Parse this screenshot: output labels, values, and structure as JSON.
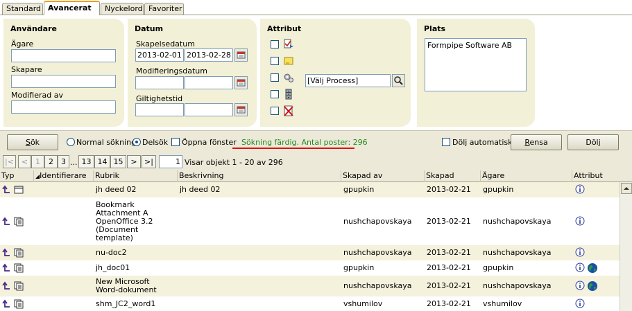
{
  "tabs": [
    {
      "label": "Standard"
    },
    {
      "label": "Avancerat"
    },
    {
      "label": "Nyckelord"
    },
    {
      "label": "Favoriter"
    }
  ],
  "panels": {
    "users": {
      "title": "Användare",
      "owner_label": "Ägare",
      "owner_value": "",
      "creator_label": "Skapare",
      "creator_value": "",
      "modified_by_label": "Modifierad av",
      "modified_by_value": ""
    },
    "dates": {
      "title": "Datum",
      "created_label": "Skapelsedatum",
      "created_from": "2013-02-01",
      "created_to": "2013-02-28",
      "modified_label": "Modifieringsdatum",
      "modified_from": "",
      "modified_to": "",
      "valid_label": "Giltighetstid",
      "valid_from": "",
      "valid_to": ""
    },
    "attributes": {
      "title": "Attribut",
      "process_value": "[Välj Process]"
    },
    "location": {
      "title": "Plats",
      "selected": "Formpipe Software AB"
    }
  },
  "toolbar": {
    "search_label": "Sök",
    "search_mnemonic": "S",
    "search_rest": "ök",
    "normal_search": "Normal sökning",
    "partial_search": "Delsök",
    "open_window": "Öppna fönster",
    "status": "Sökning färdig. Antal poster: 296",
    "hide_auto": "Dölj automatiskt",
    "clear_mnemonic": "R",
    "clear_rest": "ensa",
    "hide_label": "Dölj"
  },
  "pager": {
    "buttons": [
      "|<",
      "<",
      "1",
      "2",
      "3",
      "...",
      "13",
      "14",
      "15",
      ">",
      ">|"
    ],
    "page_value": "1",
    "info": "Visar objekt 1 - 20 av 296"
  },
  "table": {
    "columns": [
      "Typ",
      "Identifierare",
      "Rubrik",
      "Beskrivning",
      "Skapad av",
      "Skapad",
      "Ägare",
      "Attribut"
    ],
    "rows": [
      {
        "rubrik": "jh deed 02",
        "beskrivning": "jh deed 02",
        "skapad_av": "gpupkin",
        "skapad": "2013-02-21",
        "agare": "gpupkin",
        "globe": false
      },
      {
        "rubrik": "Bookmark Attachment A OpenOffice 3.2 (Document template)",
        "beskrivning": "",
        "skapad_av": "nushchapovskaya",
        "skapad": "2013-02-21",
        "agare": "nushchapovskaya",
        "globe": false
      },
      {
        "rubrik": "nu-doc2",
        "beskrivning": "",
        "skapad_av": "nushchapovskaya",
        "skapad": "2013-02-21",
        "agare": "nushchapovskaya",
        "globe": false
      },
      {
        "rubrik": "jh_doc01",
        "beskrivning": "",
        "skapad_av": "gpupkin",
        "skapad": "2013-02-21",
        "agare": "gpupkin",
        "globe": true
      },
      {
        "rubrik": "New Microsoft Word-dokument",
        "beskrivning": "",
        "skapad_av": "nushchapovskaya",
        "skapad": "2013-02-21",
        "agare": "nushchapovskaya",
        "globe": true
      },
      {
        "rubrik": "shm_JC2_word1",
        "beskrivning": "",
        "skapad_av": "vshumilov",
        "skapad": "2013-02-21",
        "agare": "vshumilov",
        "globe": false
      }
    ]
  },
  "colors": {
    "panel_bg": "#f2f0d6",
    "toolbar_bg": "#ece9d8",
    "status_green": "#1f8a1f",
    "status_underline": "#e01010",
    "row_alt": "#f4f1dc",
    "active_tab_accent": "#e8a020"
  },
  "icons": {
    "type_up": "arrow-up-left-icon",
    "type_doc": "document-icon",
    "info": "info-icon",
    "globe": "globe-icon",
    "search": "magnifier-icon",
    "calendar": "calendar-icon"
  }
}
